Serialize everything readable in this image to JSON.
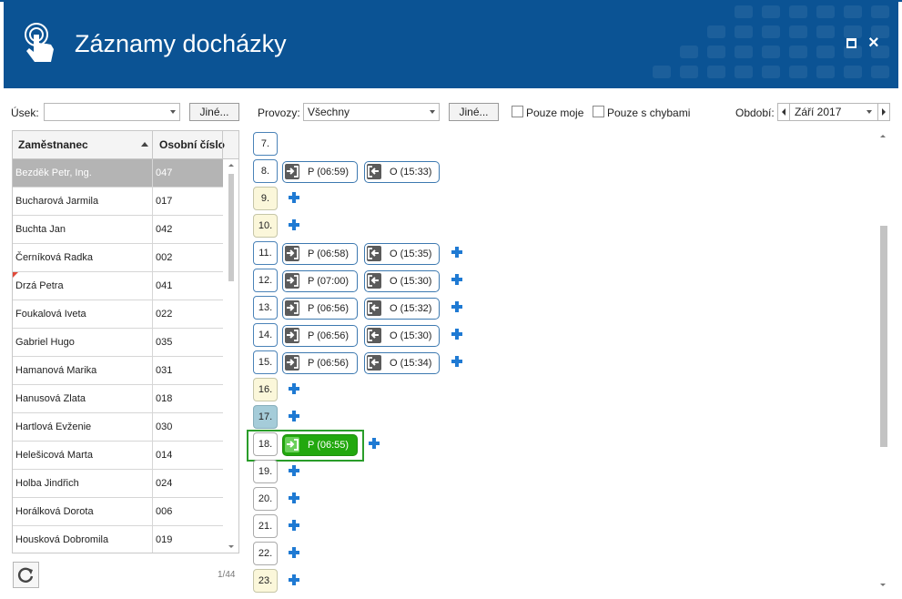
{
  "header": {
    "title": "Záznamy docházky"
  },
  "toolbar": {
    "usek_label": "Úsek:",
    "usek_value": "",
    "jine_label": "Jiné...",
    "provozy_label": "Provozy:",
    "provozy_value": "Všechny",
    "jine2_label": "Jiné...",
    "pouze_moje_label": "Pouze moje",
    "pouze_chyby_label": "Pouze s chybami",
    "obdobi_label": "Období:",
    "obdobi_value": "Září 2017"
  },
  "grid": {
    "col_name": "Zaměstnanec",
    "col_number": "Osobní číslo",
    "rows": [
      {
        "name": "Bezděk Petr, Ing.",
        "number": "047"
      },
      {
        "name": "Bucharová Jarmila",
        "number": "017"
      },
      {
        "name": "Buchta Jan",
        "number": "042"
      },
      {
        "name": "Černíková Radka",
        "number": "002"
      },
      {
        "name": "Drzá Petra",
        "number": "041"
      },
      {
        "name": "Foukalová Iveta",
        "number": "022"
      },
      {
        "name": "Gabriel Hugo",
        "number": "035"
      },
      {
        "name": "Hamanová Marika",
        "number": "031"
      },
      {
        "name": "Hanusová Zlata",
        "number": "018"
      },
      {
        "name": "Hartlová Evženie",
        "number": "030"
      },
      {
        "name": "Helešicová Marta",
        "number": "014"
      },
      {
        "name": "Holba Jindřich",
        "number": "024"
      },
      {
        "name": "Horálková Dorota",
        "number": "006"
      },
      {
        "name": "Housková Dobromila",
        "number": "019"
      }
    ],
    "counter": "1/44"
  },
  "days": [
    {
      "day": "7.",
      "in": "",
      "out": ""
    },
    {
      "day": "8.",
      "in": "P (06:59)",
      "out": "O (15:33)"
    },
    {
      "day": "9.",
      "in": "",
      "out": ""
    },
    {
      "day": "10.",
      "in": "",
      "out": ""
    },
    {
      "day": "11.",
      "in": "P (06:58)",
      "out": "O (15:35)"
    },
    {
      "day": "12.",
      "in": "P (07:00)",
      "out": "O (15:30)"
    },
    {
      "day": "13.",
      "in": "P (06:56)",
      "out": "O (15:32)"
    },
    {
      "day": "14.",
      "in": "P (06:56)",
      "out": "O (15:30)"
    },
    {
      "day": "15.",
      "in": "P (06:56)",
      "out": "O (15:34)"
    },
    {
      "day": "16.",
      "in": "",
      "out": ""
    },
    {
      "day": "17.",
      "in": "",
      "out": ""
    },
    {
      "day": "18.",
      "in": "P (06:55)",
      "out": ""
    },
    {
      "day": "19.",
      "in": "",
      "out": ""
    },
    {
      "day": "20.",
      "in": "",
      "out": ""
    },
    {
      "day": "21.",
      "in": "",
      "out": ""
    },
    {
      "day": "22.",
      "in": "",
      "out": ""
    },
    {
      "day": "23.",
      "in": "",
      "out": ""
    }
  ]
}
